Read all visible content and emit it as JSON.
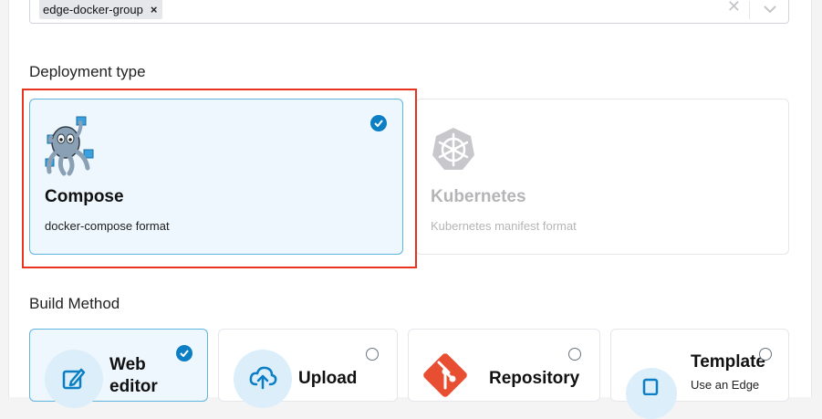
{
  "group_selector": {
    "selected_tag": "edge-docker-group",
    "remove_symbol": "×",
    "clear_symbol": "✕"
  },
  "deployment": {
    "section_title": "Deployment type",
    "options": [
      {
        "title": "Compose",
        "description": "docker-compose format",
        "selected": true,
        "icon": "docker-compose-octopus-icon"
      },
      {
        "title": "Kubernetes",
        "description": "Kubernetes manifest format",
        "selected": false,
        "icon": "kubernetes-helm-icon"
      }
    ]
  },
  "build_method": {
    "section_title": "Build Method",
    "options": [
      {
        "title_line1": "Web",
        "title_line2": "editor",
        "selected": true,
        "icon": "edit-icon"
      },
      {
        "title_line1": "Upload",
        "selected": false,
        "icon": "cloud-upload-icon"
      },
      {
        "title_line1": "Repository",
        "selected": false,
        "icon": "git-icon"
      },
      {
        "title_line1": "Template",
        "subtitle": "Use an Edge",
        "selected": false,
        "icon": "template-icon"
      }
    ]
  },
  "colors": {
    "accent": "#0b7ec4",
    "selected_bg": "#eef7fd",
    "highlight_border": "#e8331f",
    "git_orange": "#e84e31"
  }
}
